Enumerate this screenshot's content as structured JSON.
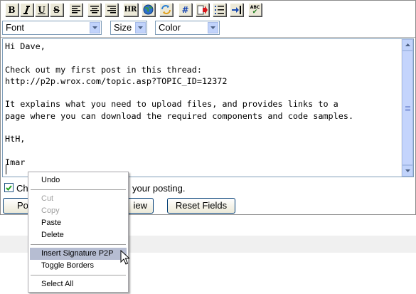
{
  "toolbar": {
    "buttons": [
      {
        "icon": "bold-icon",
        "label": "B"
      },
      {
        "icon": "italic-icon",
        "label": ""
      },
      {
        "icon": "underline-icon",
        "label": "U"
      },
      {
        "icon": "strikethrough-icon",
        "label": "S"
      },
      {
        "icon": "align-left-icon",
        "label": ""
      },
      {
        "icon": "align-center-icon",
        "label": ""
      },
      {
        "icon": "align-right-icon",
        "label": ""
      },
      {
        "icon": "horizontal-rule-icon",
        "label": "HR"
      },
      {
        "icon": "insert-link-icon",
        "label": ""
      },
      {
        "icon": "insert-image-icon",
        "label": ""
      },
      {
        "icon": "code-hash-icon",
        "label": "#"
      },
      {
        "icon": "insert-quote-icon",
        "label": ""
      },
      {
        "icon": "bulleted-list-icon",
        "label": ""
      },
      {
        "icon": "indent-icon",
        "label": ""
      },
      {
        "icon": "spellcheck-icon",
        "label": "ABC"
      }
    ]
  },
  "selects": {
    "font": "Font",
    "size": "Size",
    "color": "Color"
  },
  "editor": {
    "text": "Hi Dave,\n\nCheck out my first post in this thread:\nhttp://p2p.wrox.com/topic.asp?TOPIC_ID=12372\n\nIt explains what you need to upload files, and provides links to a\npage where you can download the required components and code samples.\n\nHtH,\n\nImar"
  },
  "options": {
    "checkbox_label_start": "Ch",
    "checkbox_label_end": "your posting.",
    "checked": true
  },
  "buttons": {
    "post": "Po",
    "preview": "iew",
    "reset": "Reset Fields"
  },
  "context_menu": {
    "undo": "Undo",
    "cut": "Cut",
    "copy": "Copy",
    "paste": "Paste",
    "delete": "Delete",
    "insert_signature": "Insert Signature P2P",
    "toggle_borders": "Toggle Borders",
    "select_all": "Select All"
  },
  "colors": {
    "menu_highlight": "#b6bdd2",
    "scroll_accent": "#c1d3fb",
    "checkbox_border": "#1c5180"
  }
}
